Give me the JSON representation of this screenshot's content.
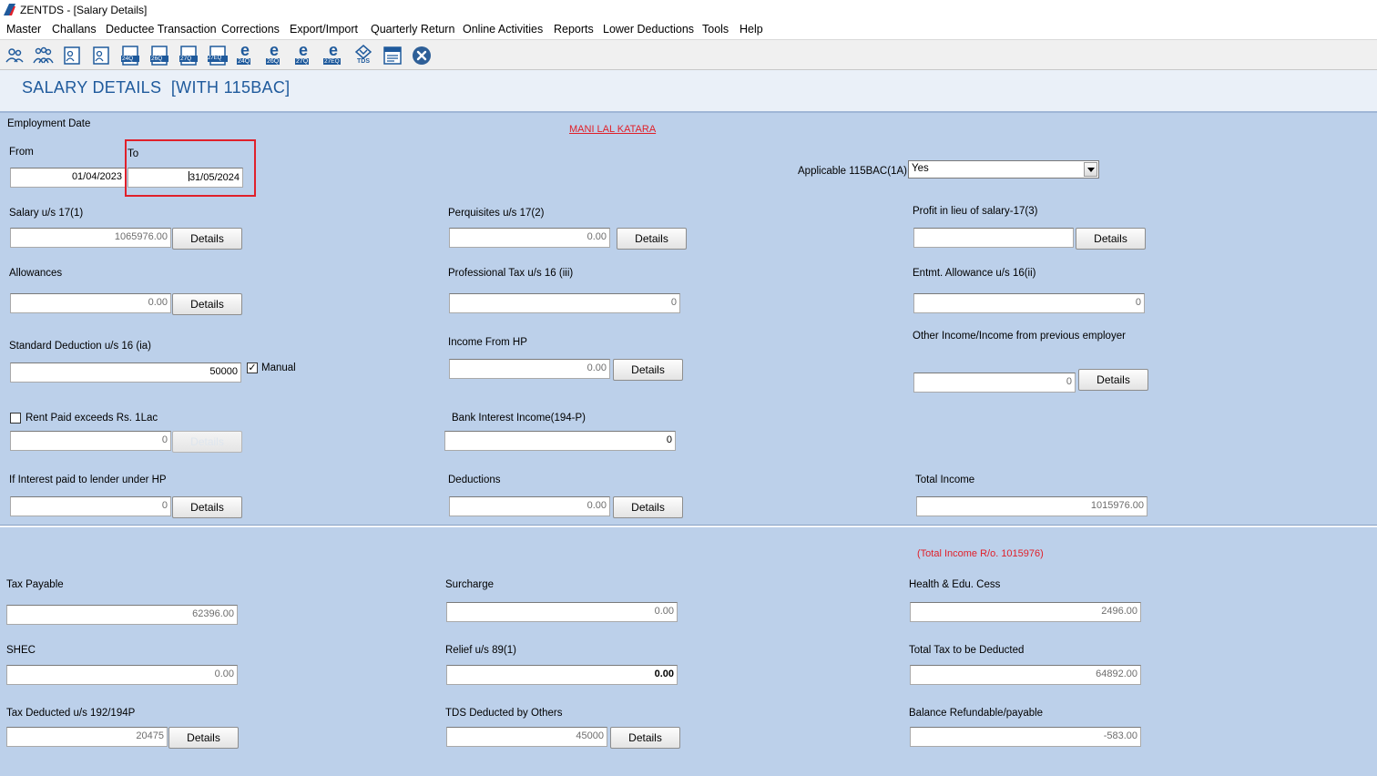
{
  "window": {
    "title": "ZENTDS - [Salary Details]"
  },
  "menu": [
    "Master",
    "Challans",
    "Deductee Transaction",
    "Corrections",
    "Export/Import",
    "Quarterly Return",
    "Online Activities",
    "Reports",
    "Lower Deductions",
    "Tools",
    "Help"
  ],
  "toolbar": {
    "icons": [
      "deductor-icon",
      "deductees-icon",
      "salary-form-icon",
      "salary-form-2-icon",
      "form-24q-icon",
      "form-26q-icon",
      "form-27q-icon",
      "form-27eq-icon",
      "efile-24q-icon",
      "efile-26q-icon",
      "efile-27q-icon",
      "efile-27eq-icon",
      "tds-icon",
      "notes-icon",
      "close-icon"
    ],
    "labels": {
      "f24q": "24Q",
      "f26q": "26Q",
      "f27q": "27Q",
      "f27eq": "27EQ",
      "e24q": "24Q",
      "e26q": "26Q",
      "e27q": "27Q",
      "e27eq": "27EQ",
      "tds": "TDS",
      "e": "e"
    }
  },
  "page_title": "SALARY DETAILS  [WITH 115BAC]",
  "employee_name": "MANI LAL KATARA",
  "employment_date": {
    "label": "Employment Date",
    "from_label": "From",
    "from_value": "01/04/2023",
    "to_label": "To",
    "to_value": "31/05/2024"
  },
  "applicable_115bac": {
    "label": "Applicable 115BAC(1A)",
    "value": "Yes"
  },
  "details_label": "Details",
  "fields": {
    "salary_17_1": {
      "label": "Salary u/s 17(1)",
      "value": "1065976.00"
    },
    "perquisites": {
      "label": "Perquisites u/s 17(2)",
      "value": "0.00"
    },
    "profit_in_lieu": {
      "label": "Profit in lieu of salary-17(3)",
      "value": ""
    },
    "allowances": {
      "label": "Allowances",
      "value": "0.00"
    },
    "professional_tax": {
      "label": "Professional Tax u/s 16 (iii)",
      "value": "0"
    },
    "entmt_allowance": {
      "label": "Entmt. Allowance u/s 16(ii)",
      "value": "0"
    },
    "standard_deduction": {
      "label": "Standard Deduction u/s 16 (ia)",
      "value": "50000",
      "manual_label": "Manual",
      "manual_checked": true
    },
    "income_from_hp": {
      "label": "Income From HP",
      "value": "0.00"
    },
    "other_income": {
      "label": "Other Income/Income from previous employer",
      "value": "0"
    },
    "rent_paid": {
      "label": "Rent Paid exceeds Rs. 1Lac",
      "checked": false,
      "value": "0"
    },
    "bank_interest": {
      "label": "Bank Interest Income(194-P)",
      "value": "0"
    },
    "interest_lender": {
      "label": "If Interest paid to lender under HP",
      "value": "0"
    },
    "deductions": {
      "label": "Deductions",
      "value": "0.00"
    },
    "total_income": {
      "label": "Total Income",
      "value": "1015976.00"
    }
  },
  "total_income_ro": "(Total Income R/o. 1015976)",
  "tax": {
    "tax_payable": {
      "label": "Tax Payable",
      "value": "62396.00"
    },
    "surcharge": {
      "label": "Surcharge",
      "value": "0.00"
    },
    "health_cess": {
      "label": "Health & Edu. Cess",
      "value": "2496.00"
    },
    "shec": {
      "label": "SHEC",
      "value": "0.00"
    },
    "relief_89": {
      "label": "Relief u/s 89(1)",
      "value": "0.00"
    },
    "total_tax": {
      "label": "Total Tax to be Deducted",
      "value": "64892.00"
    },
    "tax_deducted": {
      "label": "Tax Deducted u/s 192/194P",
      "value": "20475"
    },
    "tds_others": {
      "label": "TDS Deducted by Others",
      "value": "45000"
    },
    "balance": {
      "label": "Balance Refundable/payable",
      "value": "-583.00"
    }
  },
  "colors": {
    "accent": "#1f5a9c",
    "form_bg": "#bcd0ea",
    "highlight": "#e0202a"
  }
}
